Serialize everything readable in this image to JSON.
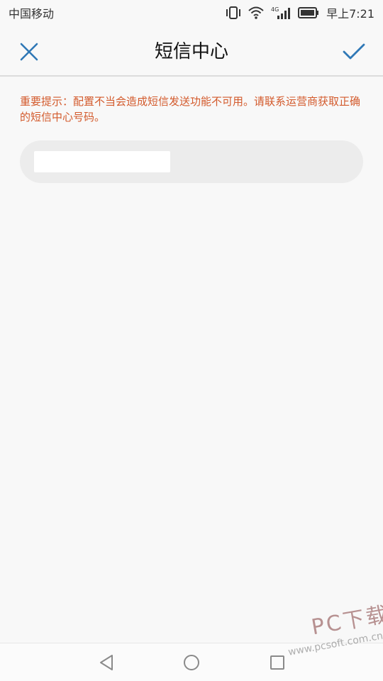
{
  "status_bar": {
    "carrier": "中国移动",
    "time": "早上7:21",
    "network_label": "4G",
    "icons": [
      "vibrate-icon",
      "wifi-icon",
      "signal-icon",
      "battery-icon"
    ]
  },
  "header": {
    "title": "短信中心",
    "close_icon": "close-icon",
    "confirm_icon": "check-icon",
    "accent_color": "#2f78b6"
  },
  "warning": {
    "text": "重要提示：配置不当会造成短信发送功能不可用。请联系运营商获取正确的短信中心号码。",
    "color": "#d35a2c"
  },
  "input": {
    "value": "",
    "placeholder": ""
  },
  "nav_bar": {
    "icons": [
      "back-icon",
      "home-icon",
      "recent-apps-icon"
    ]
  },
  "watermark": {
    "main": "PC下载网",
    "sub": "www.pcsoft.com.cn"
  }
}
